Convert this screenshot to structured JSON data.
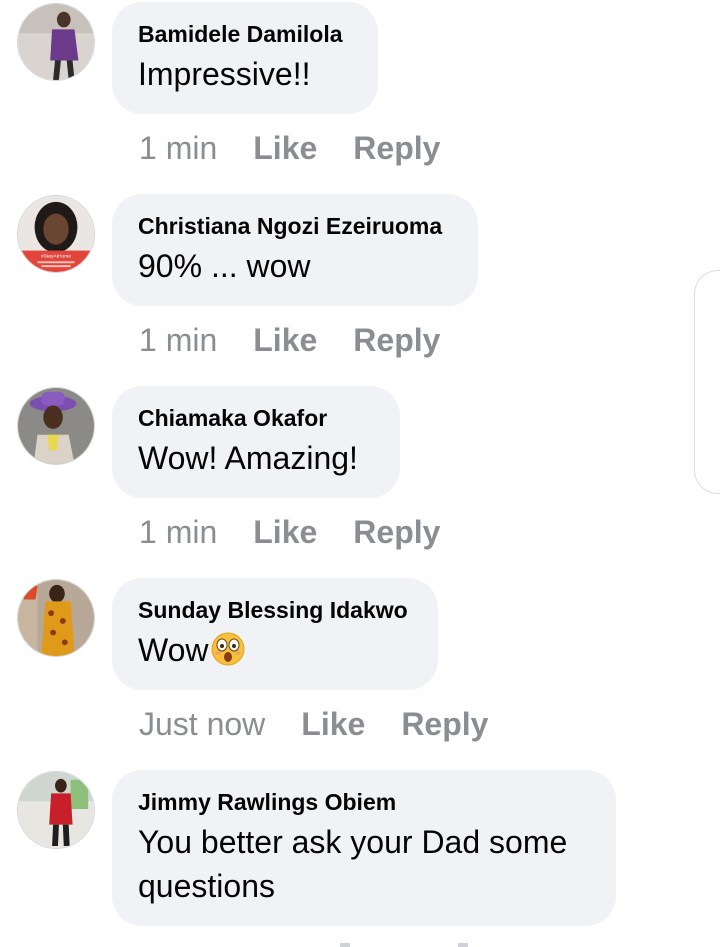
{
  "comments": [
    {
      "author": "Bamidele Damilola",
      "text": "Impressive!!",
      "time": "1 min",
      "like": "Like",
      "reply": "Reply"
    },
    {
      "author": "Christiana Ngozi Ezeiruoma",
      "text": "90% ... wow",
      "time": "1 min",
      "like": "Like",
      "reply": "Reply"
    },
    {
      "author": "Chiamaka Okafor",
      "text": "Wow! Amazing!",
      "time": "1 min",
      "like": "Like",
      "reply": "Reply"
    },
    {
      "author": "Sunday Blessing Idakwo",
      "text": "Wow",
      "emoji": "astonished-face-emoji",
      "time": "Just now",
      "like": "Like",
      "reply": "Reply"
    },
    {
      "author": "Jimmy Rawlings Obiem",
      "text": "You better ask your Dad some questions"
    }
  ],
  "colors": {
    "bubble_bg": "#f0f2f5",
    "meta_text": "#8a8d91",
    "primary_text": "#050505"
  }
}
